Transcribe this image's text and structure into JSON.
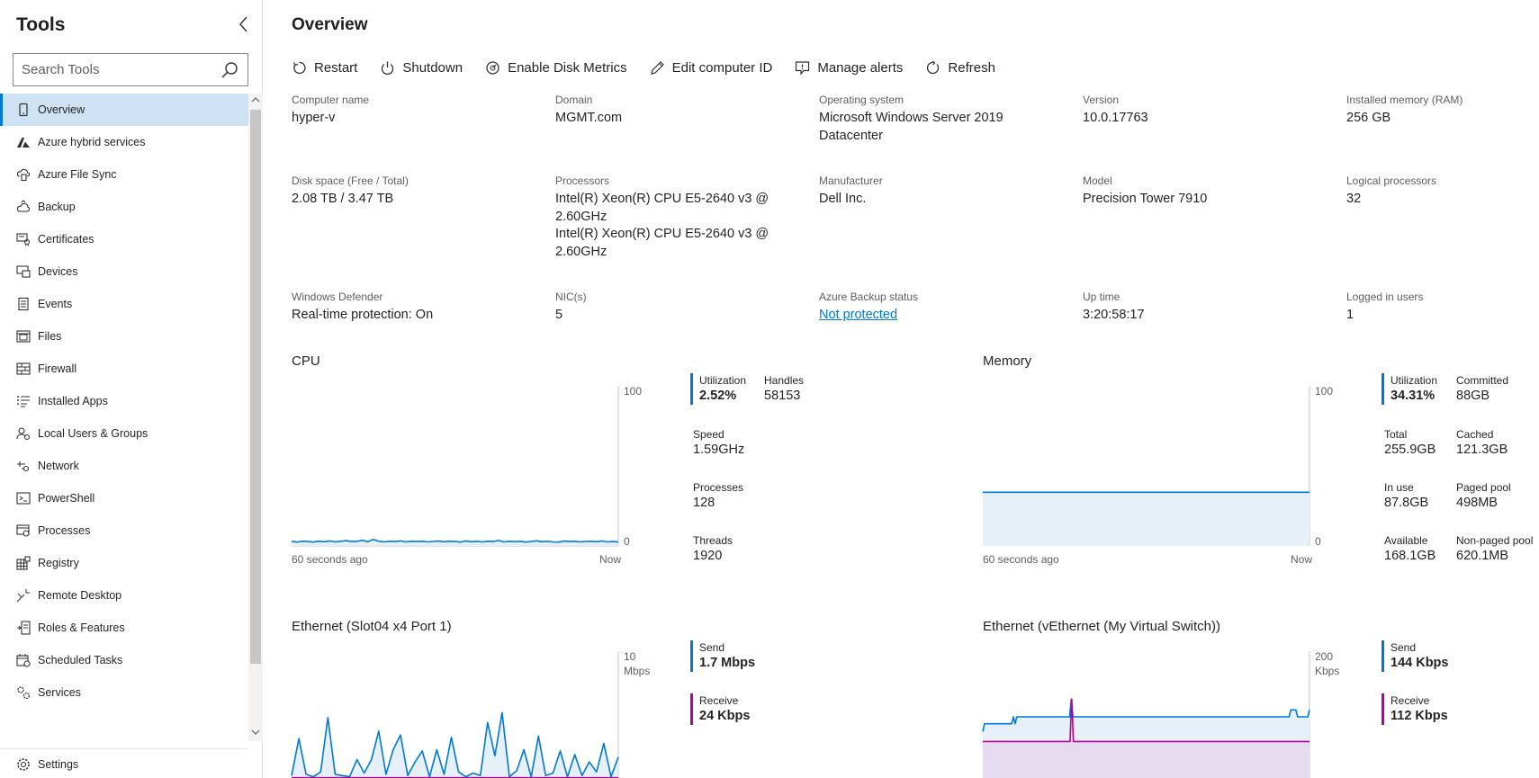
{
  "sidebar": {
    "title": "Tools",
    "search_placeholder": "Search Tools",
    "items": [
      {
        "label": "Overview",
        "icon": "device-icon",
        "active": true
      },
      {
        "label": "Azure hybrid services",
        "icon": "azure-icon"
      },
      {
        "label": "Azure File Sync",
        "icon": "cloud-sync-icon"
      },
      {
        "label": "Backup",
        "icon": "backup-icon"
      },
      {
        "label": "Certificates",
        "icon": "certificate-icon"
      },
      {
        "label": "Devices",
        "icon": "devices-icon"
      },
      {
        "label": "Events",
        "icon": "events-icon"
      },
      {
        "label": "Files",
        "icon": "files-icon"
      },
      {
        "label": "Firewall",
        "icon": "firewall-icon"
      },
      {
        "label": "Installed Apps",
        "icon": "apps-list-icon"
      },
      {
        "label": "Local Users & Groups",
        "icon": "users-icon"
      },
      {
        "label": "Network",
        "icon": "network-icon"
      },
      {
        "label": "PowerShell",
        "icon": "powershell-icon"
      },
      {
        "label": "Processes",
        "icon": "processes-icon"
      },
      {
        "label": "Registry",
        "icon": "registry-icon"
      },
      {
        "label": "Remote Desktop",
        "icon": "remote-desktop-icon"
      },
      {
        "label": "Roles & Features",
        "icon": "roles-icon"
      },
      {
        "label": "Scheduled Tasks",
        "icon": "calendar-icon"
      },
      {
        "label": "Services",
        "icon": "services-icon"
      }
    ],
    "settings_label": "Settings"
  },
  "main": {
    "title": "Overview",
    "toolbar": [
      {
        "label": "Restart",
        "icon": "restart-icon"
      },
      {
        "label": "Shutdown",
        "icon": "power-icon"
      },
      {
        "label": "Enable Disk Metrics",
        "icon": "disk-metrics-icon"
      },
      {
        "label": "Edit computer ID",
        "icon": "edit-icon"
      },
      {
        "label": "Manage alerts",
        "icon": "alert-icon"
      },
      {
        "label": "Refresh",
        "icon": "refresh-icon"
      }
    ],
    "properties": [
      {
        "label": "Computer name",
        "value": "hyper-v"
      },
      {
        "label": "Domain",
        "value": "MGMT.com"
      },
      {
        "label": "Operating system",
        "value": "Microsoft Windows Server 2019 Datacenter"
      },
      {
        "label": "Version",
        "value": "10.0.17763"
      },
      {
        "label": "Installed memory (RAM)",
        "value": "256 GB"
      },
      {
        "label": "Disk space (Free / Total)",
        "value": "2.08 TB / 3.47 TB"
      },
      {
        "label": "Processors",
        "value": "Intel(R) Xeon(R) CPU E5-2640 v3 @ 2.60GHz",
        "value2": "Intel(R) Xeon(R) CPU E5-2640 v3 @ 2.60GHz"
      },
      {
        "label": "Manufacturer",
        "value": "Dell Inc."
      },
      {
        "label": "Model",
        "value": "Precision Tower 7910"
      },
      {
        "label": "Logical processors",
        "value": "32"
      },
      {
        "label": "Windows Defender",
        "value": "Real-time protection: On"
      },
      {
        "label": "NIC(s)",
        "value": "5"
      },
      {
        "label": "Azure Backup status",
        "value": "Not protected",
        "link": true
      },
      {
        "label": "Up time",
        "value": "3:20:58:17"
      },
      {
        "label": "Logged in users",
        "value": "1"
      }
    ],
    "colors": {
      "accent": "#0078d4",
      "fill_blue": "#e5f0f9",
      "magenta": "#b4009e",
      "fill_purple": "#e6dcf0"
    }
  },
  "cpu": {
    "title": "CPU",
    "y_max_label": "100",
    "y_min_label": "0",
    "x_start_label": "60 seconds ago",
    "x_end_label": "Now",
    "metrics": {
      "utilization_label": "Utilization",
      "utilization": "2.52%",
      "handles_label": "Handles",
      "handles": "58153",
      "speed_label": "Speed",
      "speed": "1.59GHz",
      "processes_label": "Processes",
      "processes": "128",
      "threads_label": "Threads",
      "threads": "1920"
    }
  },
  "memory": {
    "title": "Memory",
    "y_max_label": "100",
    "y_min_label": "0",
    "x_start_label": "60 seconds ago",
    "x_end_label": "Now",
    "metrics": {
      "utilization_label": "Utilization",
      "utilization": "34.31%",
      "committed_label": "Committed",
      "committed": "88GB",
      "total_label": "Total",
      "total": "255.9GB",
      "cached_label": "Cached",
      "cached": "121.3GB",
      "in_use_label": "In use",
      "in_use": "87.8GB",
      "paged_pool_label": "Paged pool",
      "paged_pool": "498MB",
      "available_label": "Available",
      "available": "168.1GB",
      "non_paged_pool_label": "Non-paged pool",
      "non_paged_pool": "620.1MB"
    }
  },
  "eth1": {
    "title": "Ethernet (Slot04 x4 Port 1)",
    "y_max_label": "10",
    "y_unit_label": "Mbps",
    "metrics": {
      "send_label": "Send",
      "send": "1.7 Mbps",
      "receive_label": "Receive",
      "receive": "24 Kbps"
    }
  },
  "eth2": {
    "title": "Ethernet (vEthernet (My Virtual Switch))",
    "y_max_label": "200",
    "y_unit_label": "Kbps",
    "metrics": {
      "send_label": "Send",
      "send": "144 Kbps",
      "receive_label": "Receive",
      "receive": "112 Kbps"
    }
  },
  "chart_data": [
    {
      "type": "line",
      "title": "CPU",
      "ylim": [
        0,
        100
      ],
      "x_range": [
        "60 seconds ago",
        "Now"
      ],
      "series": [
        {
          "name": "Utilization",
          "values": [
            3,
            2.5,
            3,
            2.8,
            2.5,
            3,
            2.7,
            3.2,
            2.6,
            3,
            3.4,
            2.8,
            3,
            3.6,
            2.7,
            4.2,
            3,
            2.6,
            3,
            2.8,
            3.2,
            2.6,
            3,
            2.8,
            3,
            2.6,
            2.9,
            3.1,
            2.7,
            3,
            2.8,
            2.5,
            3.2,
            2.7,
            3,
            2.6,
            3,
            2.8,
            3.5,
            2.6,
            3,
            2.7,
            3,
            2.5,
            2.9,
            3.3,
            2.7,
            3,
            2.6,
            2.5,
            3.1,
            2.8,
            3,
            2.6,
            2.9,
            3,
            2.7,
            3.2,
            2.6,
            2.8,
            2.52
          ]
        }
      ]
    },
    {
      "type": "area",
      "title": "Memory",
      "ylim": [
        0,
        100
      ],
      "x_range": [
        "60 seconds ago",
        "Now"
      ],
      "series": [
        {
          "name": "Utilization",
          "values": [
            34.31,
            34.31
          ]
        }
      ]
    },
    {
      "type": "area",
      "title": "Ethernet (Slot04 x4 Port 1)",
      "ylim": [
        0,
        10
      ],
      "y_unit": "Mbps",
      "series": [
        {
          "name": "Send",
          "values": [
            0.2,
            3.2,
            0.3,
            0.1,
            0.5,
            4.9,
            0.3,
            0.2,
            0.1,
            1.5,
            0.4,
            1.5,
            3.8,
            0.3,
            2.3,
            3.5,
            0.2,
            1.3,
            2.2,
            0.1,
            2.3,
            0.3,
            3.3,
            0.5,
            0.1,
            0.4,
            0.2,
            4.5,
            1.8,
            5.3,
            0.1,
            0.6,
            2.3,
            0.1,
            3.4,
            0.2,
            0.4,
            2.2,
            0.1,
            1.9,
            0.2,
            1.3,
            0.5,
            2.8,
            0.1,
            1.7
          ]
        },
        {
          "name": "Receive",
          "values": [
            0.02,
            0.02
          ]
        }
      ]
    },
    {
      "type": "area",
      "title": "Ethernet (vEthernet (My Virtual Switch))",
      "ylim": [
        0,
        200
      ],
      "y_unit": "Kbps",
      "series": [
        {
          "name": "Send",
          "values": [
            122,
            130,
            130,
            130,
            130,
            130,
            130,
            130,
            130,
            130,
            130,
            130,
            130,
            130,
            130,
            130,
            130,
            130,
            137,
            130,
            137,
            137,
            137,
            137,
            137,
            137,
            137,
            137,
            137,
            137,
            137,
            137,
            137,
            137,
            137,
            137,
            137,
            137,
            137,
            137,
            137,
            137,
            137,
            137,
            137,
            137,
            137,
            137,
            137,
            137,
            137,
            137,
            155,
            137,
            137,
            137,
            137,
            137,
            137,
            137,
            137,
            137,
            137,
            137,
            137,
            137,
            137,
            137,
            137,
            137,
            137,
            137,
            137,
            137,
            137,
            137,
            137,
            137,
            137,
            137,
            137,
            137,
            137,
            137,
            137,
            137,
            137,
            137,
            137,
            137,
            137,
            137,
            137,
            137,
            137,
            137,
            137,
            137,
            137,
            137,
            137,
            137,
            137,
            137,
            137,
            137,
            137,
            137,
            137,
            137,
            137,
            137,
            137,
            137,
            137,
            137,
            137,
            137,
            137,
            137,
            137,
            137,
            137,
            137,
            137,
            137,
            137,
            137,
            137,
            137,
            137,
            137,
            137,
            137,
            137,
            137,
            137,
            137,
            137,
            137,
            137,
            137,
            137,
            137,
            137,
            137,
            137,
            137,
            137,
            137,
            137,
            137,
            137,
            137,
            137,
            137,
            137,
            137,
            137,
            137,
            137,
            137,
            137,
            137,
            137,
            137,
            137,
            137,
            137,
            137,
            137,
            137,
            137,
            137,
            137,
            137,
            137,
            137,
            137,
            137,
            137,
            144,
            144,
            144,
            144,
            137,
            137,
            137,
            137,
            137,
            137,
            137,
            144
          ]
        },
        {
          "name": "Receive",
          "values": [
            112,
            112,
            112,
            112,
            112,
            112,
            112,
            112,
            112,
            112,
            112,
            112,
            112,
            112,
            112,
            112,
            112,
            112,
            112,
            112,
            112,
            112,
            112,
            112,
            112,
            112,
            112,
            112,
            112,
            112,
            112,
            112,
            112,
            112,
            112,
            112,
            112,
            112,
            112,
            112,
            112,
            112,
            112,
            112,
            112,
            112,
            112,
            112,
            112,
            112,
            112,
            112,
            155,
            112,
            112,
            112,
            112,
            112,
            112,
            112,
            112,
            112,
            112,
            112,
            112,
            112,
            112,
            112,
            112,
            112,
            112,
            112,
            112,
            112,
            112,
            112,
            112,
            112,
            112,
            112,
            112,
            112,
            112,
            112,
            112,
            112,
            112,
            112,
            112,
            112,
            112,
            112,
            112,
            112,
            112,
            112,
            112,
            112,
            112,
            112,
            112,
            112,
            112,
            112,
            112,
            112,
            112,
            112,
            112,
            112,
            112,
            112,
            112,
            112,
            112,
            112,
            112,
            112,
            112,
            112,
            112,
            112,
            112,
            112,
            112,
            112,
            112,
            112,
            112,
            112,
            112,
            112,
            112,
            112,
            112,
            112,
            112,
            112,
            112,
            112,
            112,
            112,
            112,
            112,
            112,
            112,
            112,
            112,
            112,
            112,
            112,
            112,
            112,
            112,
            112,
            112,
            112,
            112,
            112,
            112,
            112,
            112,
            112,
            112,
            112,
            112,
            112,
            112,
            112,
            112,
            112,
            112,
            112,
            112,
            112,
            112,
            112,
            112,
            112,
            112,
            112,
            112,
            112,
            112,
            112,
            112,
            112,
            112,
            112,
            112,
            112,
            112
          ]
        }
      ]
    }
  ]
}
